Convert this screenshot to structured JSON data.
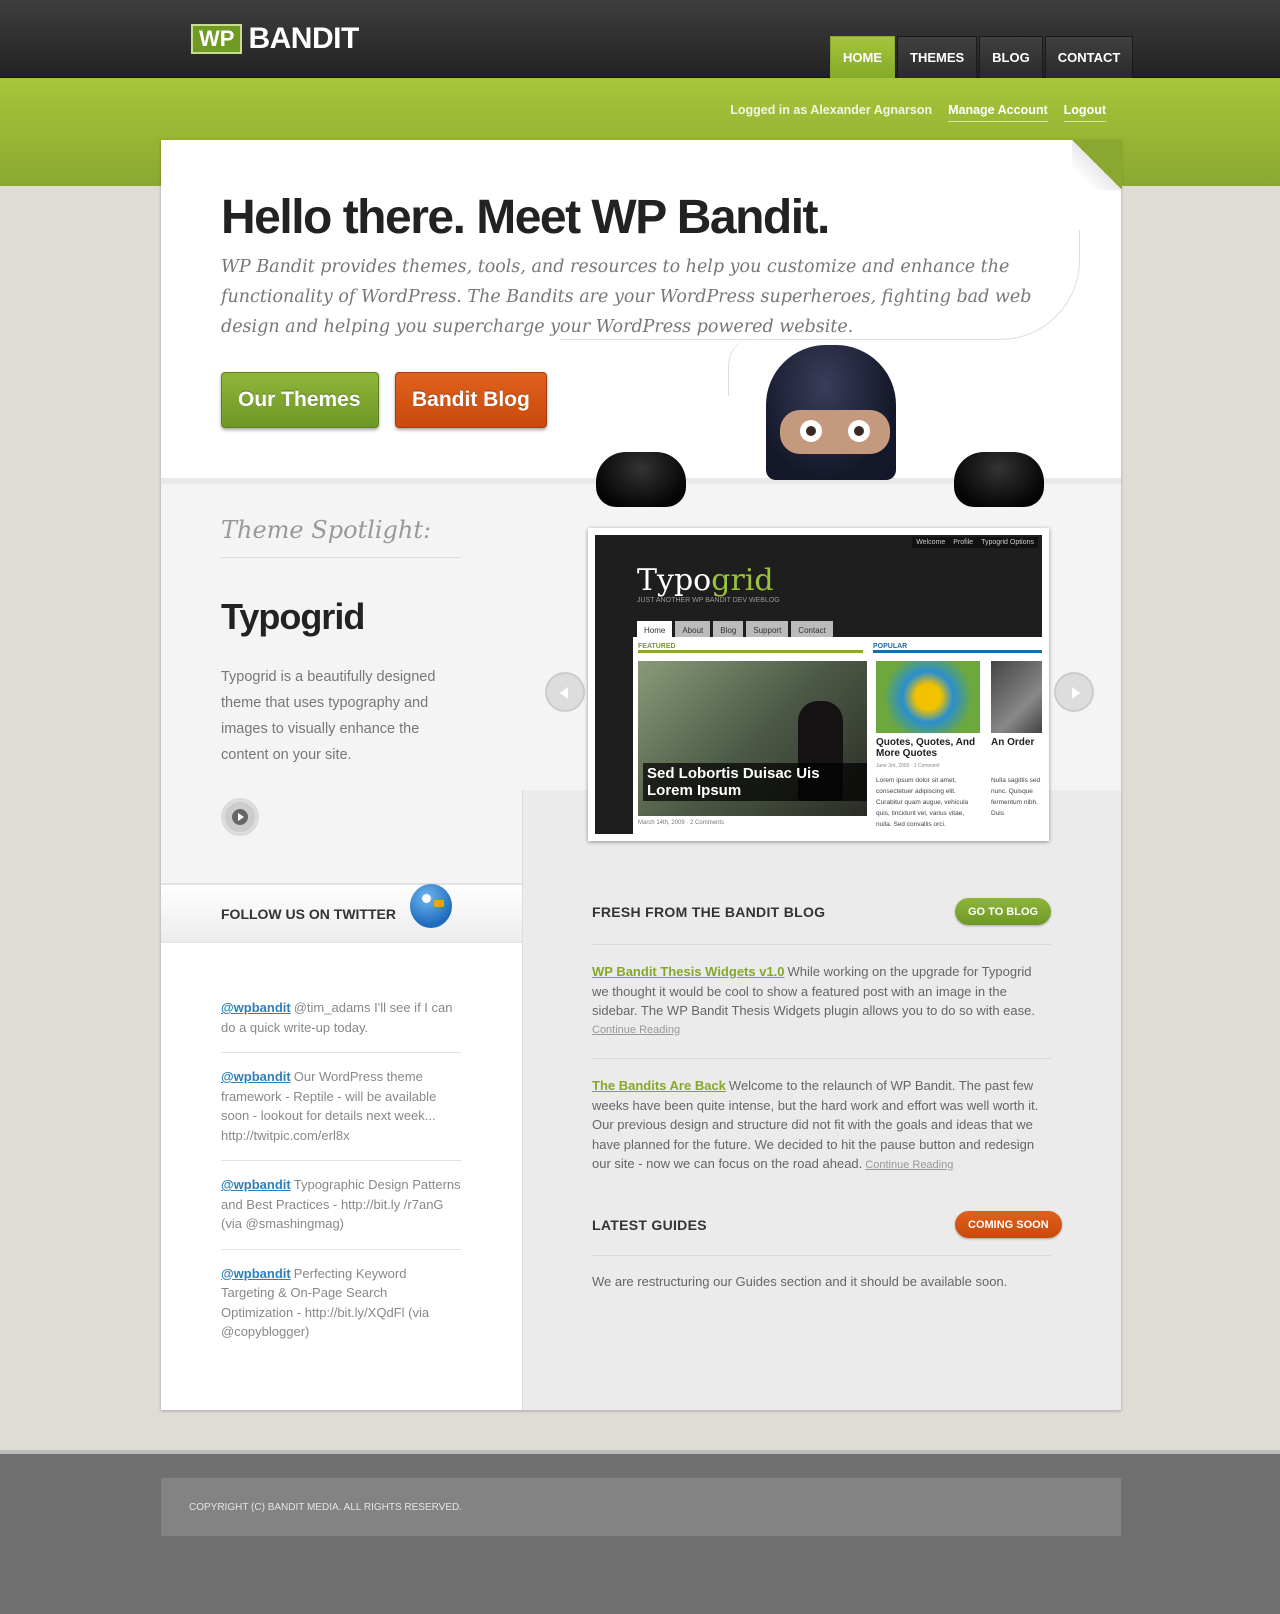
{
  "logo": {
    "badge": "WP",
    "name": "BANDIT"
  },
  "nav": {
    "items": [
      "HOME",
      "THEMES",
      "BLOG",
      "CONTACT"
    ],
    "active": "HOME"
  },
  "userbar": {
    "logged_in": "Logged in as Alexander Agnarson",
    "manage": "Manage Account",
    "logout": "Logout"
  },
  "hero": {
    "title": "Hello there. Meet WP Bandit.",
    "description": "WP Bandit provides themes, tools, and resources to help you customize and enhance the functionality of WordPress. The Bandits are your WordPress superheroes, fighting bad web design and helping you supercharge your WordPress powered website.",
    "btn_themes": "Our Themes",
    "btn_blog": "Bandit Blog"
  },
  "spotlight": {
    "label": "Theme Spotlight:",
    "title": "Typogrid",
    "description": "Typogrid is a beautifully designed theme that uses typography and images to visually enhance the content on your site."
  },
  "preview": {
    "topnav": [
      "Welcome ",
      "Profile",
      "Typogrid Options"
    ],
    "site_title_a": "Typo",
    "site_title_b": "grid",
    "tagline": "JUST ANOTHER WP BANDIT DEV WEBLOG",
    "tabs": [
      "Home",
      "About",
      "Blog",
      "Support",
      "Contact"
    ],
    "featured_label": "FEATURED",
    "popular_label": "POPULAR",
    "caption": "Sed Lobortis Duisac Uis Lorem Ipsum",
    "meta": "March 14th, 2009  ·  2 Comments",
    "pop_title": "Quotes, Quotes, And More Quotes",
    "pop_title2": "An Order",
    "pop_date": "June 3rd, 2009  ·  1 Comment",
    "pop_text": "Lorem ipsum dolor sit amet, consectetuer adipiscing elit. Curabitur quam augue, vehicula quis, tincidunt vel, varius vitae, nulla. Sed convallis orci.",
    "pop_text2": "Nulla sagittis sed nunc. Quisque fermentum nibh. Duis"
  },
  "twitter": {
    "title": "FOLLOW US ON TWITTER",
    "tweets": [
      {
        "user": "@wpbandit",
        "text": "@tim_adams I'll see if I can do a quick write-up today."
      },
      {
        "user": "@wpbandit",
        "text": "Our WordPress theme framework - Reptile - will be available soon - lookout for details next week... http://twitpic.com/erl8x"
      },
      {
        "user": "@wpbandit",
        "text": "Typographic Design Patterns and Best Practices - http://bit.ly /r7anG (via @smashingmag)"
      },
      {
        "user": "@wpbandit",
        "text": "Perfecting Keyword Targeting & On-Page Search Optimization - http://bit.ly/XQdFl (via @copyblogger)"
      }
    ]
  },
  "blog": {
    "title": "FRESH FROM THE BANDIT BLOG",
    "button": "GO TO BLOG",
    "posts": [
      {
        "title": "WP Bandit Thesis Widgets v1.0",
        "text": "While working on the upgrade for Typogrid we thought it would be cool to show a featured post with an image in the sidebar. The WP Bandit Thesis Widgets plugin allows you to do so with ease.",
        "more": "Continue Reading"
      },
      {
        "title": "The Bandits Are Back",
        "text": "Welcome to the relaunch of WP Bandit. The past few weeks have been quite intense, but the hard work and effort was well worth it. Our previous design and structure did not fit with the goals and ideas that we have planned for the future. We decided to hit the pause button and redesign our site - now we can focus on the road ahead.",
        "more": "Continue Reading"
      }
    ]
  },
  "guides": {
    "title": "LATEST GUIDES",
    "button": "COMING SOON",
    "text": "We are restructuring our Guides section and it should be available soon."
  },
  "footer": {
    "copyright": "COPYRIGHT (C) BANDIT MEDIA. ALL RIGHTS RESERVED."
  },
  "colors": {
    "green": "#8aa830",
    "orange": "#d0540f",
    "dark": "#2b2b2b",
    "link_blue": "#2f7fb8"
  }
}
